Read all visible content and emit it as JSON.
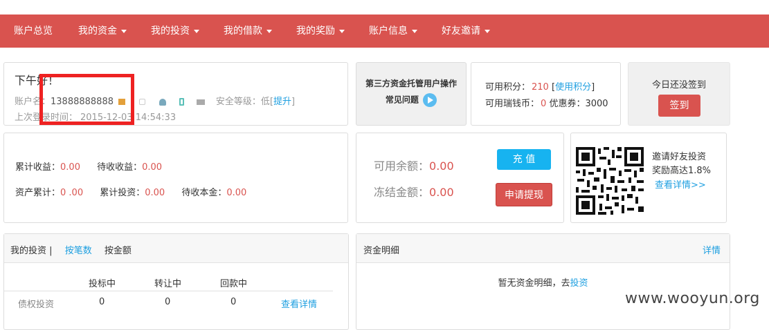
{
  "nav": {
    "items": [
      {
        "label": "账户总览",
        "dropdown": false
      },
      {
        "label": "我的资金",
        "dropdown": true
      },
      {
        "label": "我的投资",
        "dropdown": true
      },
      {
        "label": "我的借款",
        "dropdown": true
      },
      {
        "label": "我的奖励",
        "dropdown": true
      },
      {
        "label": "账户信息",
        "dropdown": true
      },
      {
        "label": "好友邀请",
        "dropdown": true
      }
    ]
  },
  "account": {
    "greeting": "下午好！",
    "name_label": "账户名：",
    "name_value": "13888888888",
    "security_label": "安全等级：",
    "security_value": "低",
    "upgrade_link": "提升",
    "bracket_open": "[",
    "bracket_close": "]",
    "last_login_label": "上次登录时间：",
    "last_login_value": "2015-12-03 14:54:33",
    "icons": [
      "id-card-icon",
      "lock-icon",
      "user-icon",
      "phone-icon",
      "mail-icon"
    ]
  },
  "faq": {
    "line1": "第三方资金托管用户操作",
    "line2": "常见问题"
  },
  "points": {
    "points_label": "可用积分：",
    "points_value": "210",
    "use_points_link": "使用积分",
    "bracket_open": "[",
    "bracket_close": "]",
    "coins_label": "可用瑞钱币：",
    "coins_value": "0",
    "coupon_label": "优惠券：",
    "coupon_value": "3000"
  },
  "signin": {
    "text": "今日还没签到",
    "button": "签到"
  },
  "income": {
    "total_income_label": "累计收益：",
    "total_income_value": "0.00",
    "pending_income_label": "待收收益：",
    "pending_income_value": "0.00",
    "asset_total_label": "资产累计：",
    "asset_total_value": "0 .00",
    "total_invest_label": "累计投资：",
    "total_invest_value": "0.00",
    "pending_principal_label": "待收本金：",
    "pending_principal_value": "0.00"
  },
  "balance": {
    "available_label": "可用余额：",
    "available_value": "0.00",
    "frozen_label": "冻结金额：",
    "frozen_value": "0.00",
    "recharge_button": "充 值",
    "withdraw_button": "申请提现"
  },
  "invite": {
    "line1": "邀请好友投资",
    "line2": "奖励高达1.8%",
    "link": "查看详情>>"
  },
  "investments": {
    "title": "我的投资",
    "separator": "|",
    "tab_count": "按笔数",
    "tab_amount": "按金额",
    "columns": [
      "投标中",
      "转让中",
      "回款中"
    ],
    "rows": [
      {
        "name": "债权投资",
        "values": [
          "0",
          "0",
          "0"
        ],
        "link": "查看详情"
      }
    ]
  },
  "funds": {
    "title": "资金明细",
    "detail_link": "详情",
    "empty_text": "暂无资金明细，去",
    "invest_link": "投资"
  },
  "watermark": "www.wooyun.org",
  "colors": {
    "nav": "#d9534f",
    "accent_red": "#d9534f",
    "accent_blue": "#1e9fe0",
    "recharge": "#17b3f0",
    "highlight_box": "#ee2222"
  }
}
